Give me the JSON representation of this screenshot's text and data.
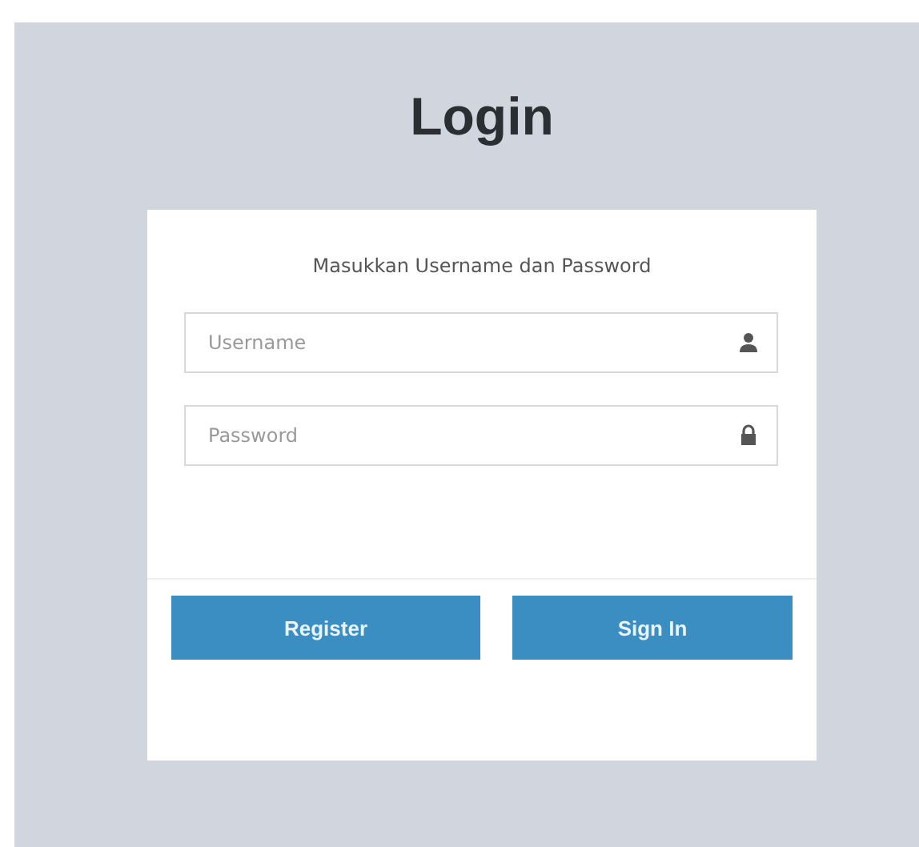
{
  "title": "Login",
  "subtitle": "Masukkan Username dan Password",
  "fields": [
    {
      "kind": "user",
      "placeholder": "Username"
    },
    {
      "kind": "lock",
      "placeholder": "Password"
    }
  ],
  "buttons": [
    "Register",
    "Sign In"
  ]
}
